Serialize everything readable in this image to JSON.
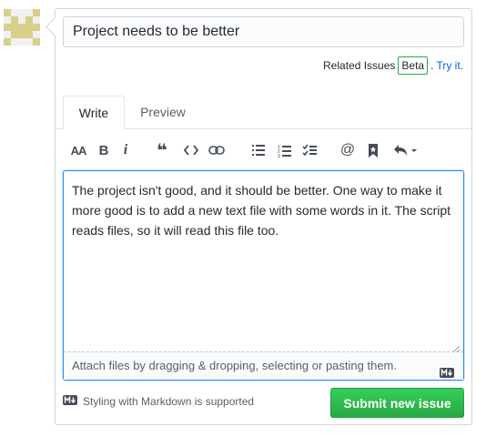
{
  "issue": {
    "title_value": "Project needs to be better",
    "related_label": "Related Issues",
    "beta_badge": "Beta",
    "try_it_link": "Try it."
  },
  "tabs": [
    {
      "label": "Write",
      "active": true
    },
    {
      "label": "Preview",
      "active": false
    }
  ],
  "toolbar": {
    "icons": [
      "text-size-icon",
      "bold-icon",
      "italic-icon",
      "quote-icon",
      "code-icon",
      "link-icon",
      "unordered-list-icon",
      "ordered-list-icon",
      "task-list-icon",
      "mention-icon",
      "bookmark-icon",
      "reply-icon"
    ],
    "heading_glyph": "AA",
    "bold_glyph": "B",
    "italic_glyph": "i",
    "quote_glyph": "❝",
    "mention_glyph": "@"
  },
  "editor": {
    "body": "The project isn't good, and it should be better. One way to make it more good is to add a new text file with some words in it. The script reads files, so it will read this file too.",
    "attach_hint": "Attach files by dragging & dropping, selecting or pasting them."
  },
  "footer": {
    "markdown_note": "Styling with Markdown is supported",
    "submit_label": "Submit new issue"
  },
  "colors": {
    "avatar": "#d7d08a",
    "accent_blue": "#0366d6",
    "submit_green": "#28a745"
  }
}
